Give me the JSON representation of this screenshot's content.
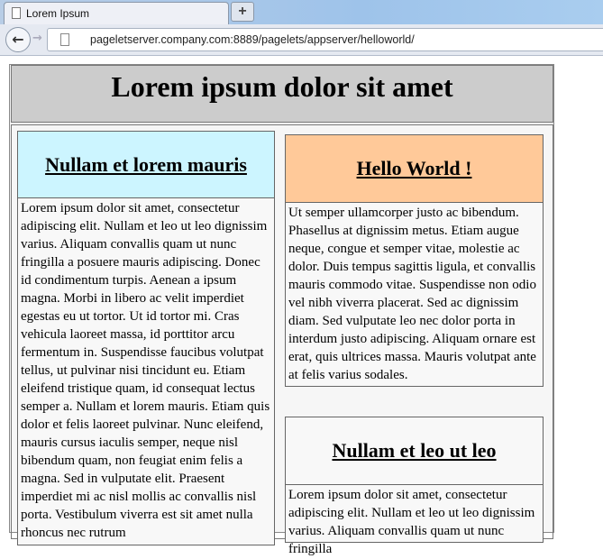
{
  "browser": {
    "tab_title": "Lorem Ipsum",
    "new_tab_label": "+",
    "url": "pageletserver.company.com:8889/pagelets/appserver/helloworld/"
  },
  "page": {
    "title": "Lorem ipsum dolor sit amet",
    "panels": [
      {
        "heading": "Nullam et lorem mauris",
        "color": "#ccf5ff",
        "body": "Lorem ipsum dolor sit amet, consectetur adipiscing elit. Nullam et leo ut leo dignissim varius. Aliquam convallis quam ut nunc fringilla a posuere mauris adipiscing. Donec id condimentum turpis. Aenean a ipsum magna. Morbi in libero ac velit imperdiet egestas eu ut tortor. Ut id tortor mi. Cras vehicula laoreet massa, id porttitor arcu fermentum in. Suspendisse faucibus volutpat tellus, ut pulvinar nisi tincidunt eu. Etiam eleifend tristique quam, id consequat lectus semper a. Nullam et lorem mauris. Etiam quis dolor et felis laoreet pulvinar. Nunc eleifend, mauris cursus iaculis semper, neque nisl bibendum quam, non feugiat enim felis a magna. Sed in vulputate elit. Praesent imperdiet mi ac nisl mollis ac convallis nisl porta. Vestibulum viverra est sit amet nulla rhoncus nec rutrum"
      },
      {
        "heading": "Hello World !",
        "color": "#ffc999",
        "body": "Ut semper ullamcorper justo ac bibendum. Phasellus at dignissim metus. Etiam augue neque, congue et semper vitae, molestie ac dolor. Duis tempus sagittis ligula, et convallis mauris commodo vitae. Suspendisse non odio vel nibh viverra placerat. Sed ac dignissim diam. Sed vulputate leo nec dolor porta in interdum justo adipiscing. Aliquam ornare est erat, quis ultrices massa. Mauris volutpat ante at felis varius sodales."
      },
      {
        "heading": "Nullam et leo ut leo",
        "color": "#f8f8f8",
        "body": "Lorem ipsum dolor sit amet, consectetur adipiscing elit. Nullam et leo ut leo dignissim varius. Aliquam convallis quam ut nunc fringilla"
      }
    ]
  }
}
